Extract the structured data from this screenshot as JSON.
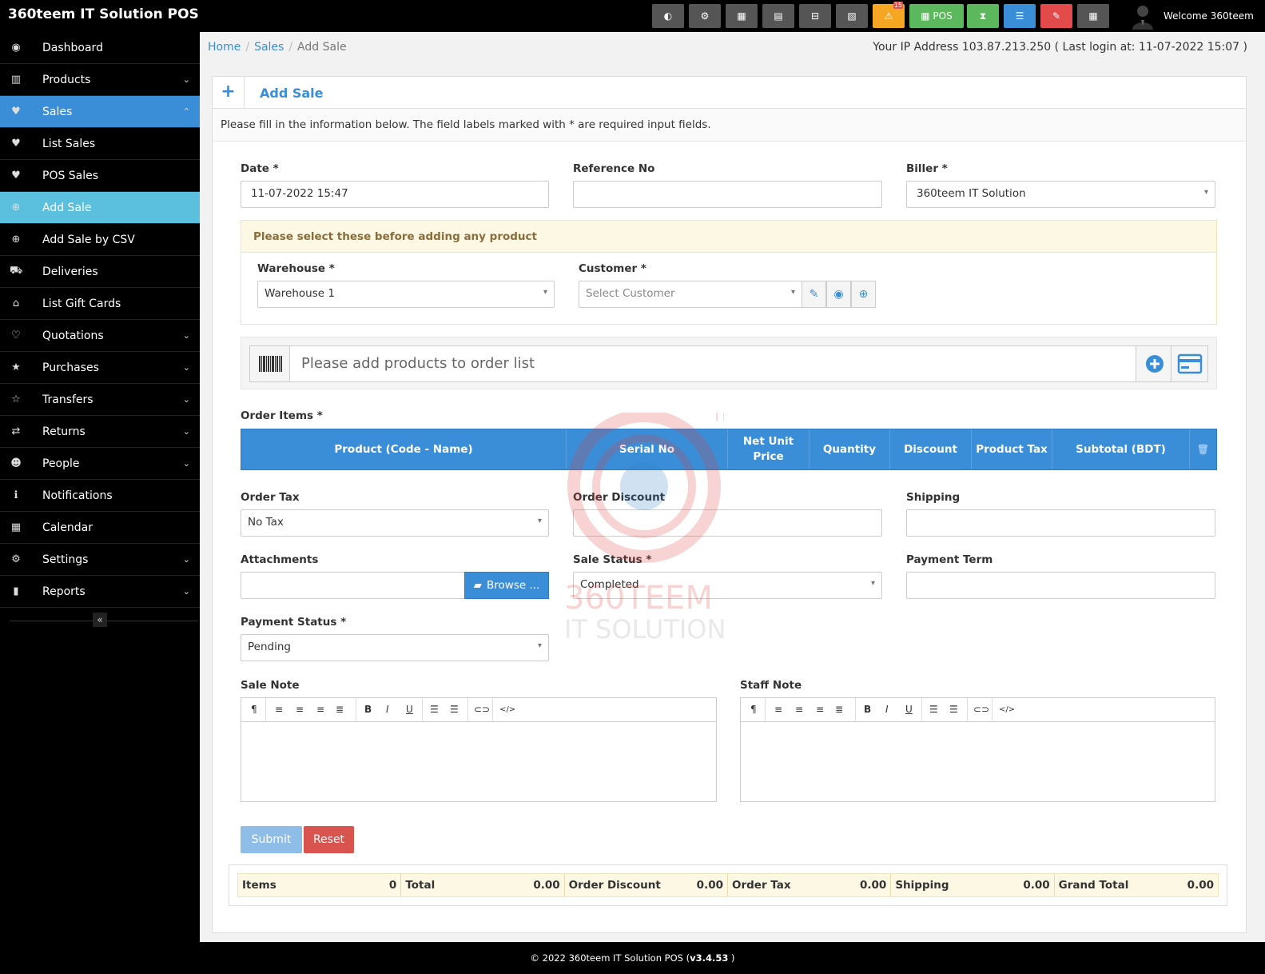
{
  "app": {
    "brand": "360teem IT Solution POS",
    "welcome": "Welcome 360teem"
  },
  "topbar": {
    "buttons": [
      {
        "name": "dashboard-icon",
        "label": "◐"
      },
      {
        "name": "cogs-icon",
        "label": "⚙"
      },
      {
        "name": "calculator-icon",
        "label": "▦"
      },
      {
        "name": "calendar-icon",
        "label": "▤"
      },
      {
        "name": "clear-cache-icon",
        "label": "⊟"
      },
      {
        "name": "language-flag-icon",
        "label": "▧"
      },
      {
        "name": "alert-icon",
        "label": "⚠",
        "badge": "15"
      },
      {
        "name": "pos-button",
        "label": "▦ POS"
      },
      {
        "name": "hourglass-icon",
        "label": "⧗"
      },
      {
        "name": "list-icon",
        "label": "☰"
      },
      {
        "name": "eraser-icon",
        "label": "✎"
      },
      {
        "name": "grid-icon",
        "label": "▦"
      }
    ]
  },
  "sidebar": {
    "items": [
      {
        "label": "Dashboard",
        "icon": "◉",
        "chevron": ""
      },
      {
        "label": "Products",
        "icon": "▥",
        "chevron": "⌄"
      },
      {
        "label": "Sales",
        "icon": "♥",
        "chevron": "⌃"
      },
      {
        "label": "List Sales",
        "icon": "♥",
        "chevron": ""
      },
      {
        "label": "POS Sales",
        "icon": "♥",
        "chevron": ""
      },
      {
        "label": "Add Sale",
        "icon": "⊕",
        "chevron": ""
      },
      {
        "label": "Add Sale by CSV",
        "icon": "⊕",
        "chevron": ""
      },
      {
        "label": "Deliveries",
        "icon": "⛟",
        "chevron": ""
      },
      {
        "label": "List Gift Cards",
        "icon": "⌂",
        "chevron": ""
      },
      {
        "label": "Quotations",
        "icon": "♡",
        "chevron": "⌄"
      },
      {
        "label": "Purchases",
        "icon": "★",
        "chevron": "⌄"
      },
      {
        "label": "Transfers",
        "icon": "☆",
        "chevron": "⌄"
      },
      {
        "label": "Returns",
        "icon": "⇄",
        "chevron": "⌄"
      },
      {
        "label": "People",
        "icon": "☻",
        "chevron": "⌄"
      },
      {
        "label": "Notifications",
        "icon": "ℹ",
        "chevron": ""
      },
      {
        "label": "Calendar",
        "icon": "▦",
        "chevron": ""
      },
      {
        "label": "Settings",
        "icon": "⚙",
        "chevron": "⌄"
      },
      {
        "label": "Reports",
        "icon": "▮",
        "chevron": "⌄"
      }
    ],
    "collapse": "«"
  },
  "breadcrumb": {
    "home": "Home",
    "sales": "Sales",
    "current": "Add Sale",
    "sep": "/"
  },
  "ip_info": "Your IP Address 103.87.213.250 ( Last login at: 11-07-2022 15:07 )",
  "panel": {
    "plus": "+",
    "title": "Add Sale",
    "intro": "Please fill in the information below. The field labels marked with * are required input fields."
  },
  "form": {
    "date": {
      "label": "Date *",
      "value": "11-07-2022 15:47"
    },
    "reference": {
      "label": "Reference No",
      "value": ""
    },
    "biller": {
      "label": "Biller *",
      "value": "360teem IT Solution"
    },
    "notice": "Please select these before adding any product",
    "warehouse": {
      "label": "Warehouse *",
      "value": "Warehouse 1"
    },
    "customer": {
      "label": "Customer *",
      "placeholder": "Select Customer"
    },
    "product_search": {
      "placeholder": "Please add products to order list"
    },
    "order_items_label": "Order Items *",
    "columns": [
      "Product (Code - Name)",
      "Serial No",
      "Net Unit Price",
      "Quantity",
      "Discount",
      "Product Tax",
      "Subtotal (BDT)"
    ],
    "order_tax": {
      "label": "Order Tax",
      "value": "No Tax"
    },
    "order_discount": {
      "label": "Order Discount",
      "value": ""
    },
    "shipping": {
      "label": "Shipping",
      "value": ""
    },
    "attachments": {
      "label": "Attachments",
      "browse": "Browse ..."
    },
    "sale_status": {
      "label": "Sale Status *",
      "value": "Completed"
    },
    "payment_term": {
      "label": "Payment Term",
      "value": ""
    },
    "payment_status": {
      "label": "Payment Status *",
      "value": "Pending"
    },
    "sale_note": {
      "label": "Sale Note"
    },
    "staff_note": {
      "label": "Staff Note"
    },
    "submit": "Submit",
    "reset": "Reset"
  },
  "totals": [
    {
      "label": "Items",
      "value": "0"
    },
    {
      "label": "Total",
      "value": "0.00"
    },
    {
      "label": "Order Discount",
      "value": "0.00"
    },
    {
      "label": "Order Tax",
      "value": "0.00"
    },
    {
      "label": "Shipping",
      "value": "0.00"
    },
    {
      "label": "Grand Total",
      "value": "0.00"
    }
  ],
  "footer": {
    "text": "© 2022 360teem IT Solution POS (",
    "version": "v3.4.53",
    "close": " )"
  },
  "watermark": {
    "name": "360TEEM",
    "sub": "IT SOLUTION",
    "tm": "TM"
  },
  "colors": {
    "primary": "#3a8ed8",
    "sidebar_active": "#3a8ed8",
    "sidebar_sub_active": "#5bc0de",
    "danger": "#d9534f",
    "warning_bg": "#fcf8e3"
  }
}
